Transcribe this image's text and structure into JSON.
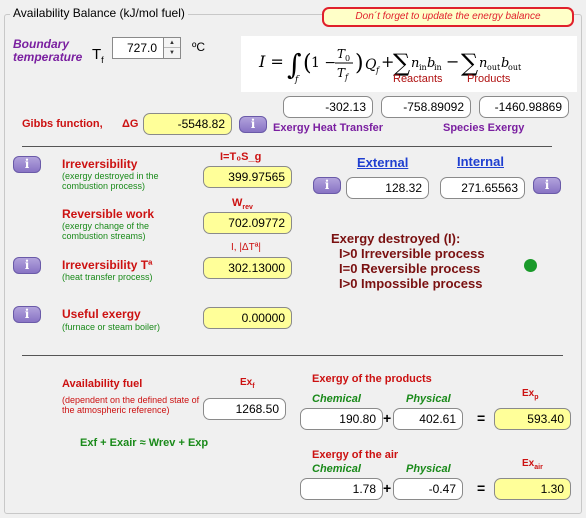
{
  "frame_title": "Availability Balance (kJ/mol fuel)",
  "banner": "Don´t forget to update the energy balance",
  "boundary": {
    "label1": "Boundary",
    "label2": "temperature",
    "symbol": "T",
    "subscript": "f",
    "value": "727.0",
    "unit": "ºC"
  },
  "formula": {
    "reactants": "Reactants",
    "products": "Products"
  },
  "formula_values": [
    "-302.13",
    "-758.89092",
    "-1460.98869"
  ],
  "gibbs": {
    "label": "Gibbs function,",
    "symbol": "ΔG",
    "value": "-5548.82",
    "exergy_heat": "Exergy Heat Transfer",
    "species_exergy": "Species Exergy"
  },
  "irreversibility": {
    "title": "Irreversibility",
    "desc": "(exergy destroyed in the combustion process)",
    "formula": "I=T₀S_g",
    "value": "399.97565"
  },
  "external_internal": {
    "external_label": "External",
    "internal_label": "Internal",
    "external_value": "128.32",
    "internal_value": "271.65563"
  },
  "reversible": {
    "title": "Reversible work",
    "desc": "(exergy change of the combustion streams)",
    "symbol": "W",
    "subscript": "rev",
    "value": "702.09772"
  },
  "exergy_destroyed": {
    "title": "Exergy destroyed (I):",
    "lines": [
      "I>0 Irreversible process",
      "I=0 Reversible process",
      "I>0 Impossible process"
    ],
    "status_color": "#1a9a2a"
  },
  "irrev_t": {
    "title": "Irreversibility Tª",
    "desc": "(heat transfer process)",
    "formula": "I, |ΔTª|",
    "value": "302.13000"
  },
  "useful": {
    "title": "Useful exergy",
    "desc": "(furnace or steam boiler)",
    "value": "0.00000"
  },
  "availability": {
    "title": "Availability fuel",
    "desc": "(dependent on the defined state of the atmospheric reference)",
    "symbol": "Ex",
    "subscript": "f",
    "value": "1268.50",
    "equation": "Exf + Exair ≈ Wrev + Exp"
  },
  "products": {
    "title": "Exergy of the products",
    "chemical_label": "Chemical",
    "physical_label": "Physical",
    "chemical": "190.80",
    "physical": "402.61",
    "symbol": "Ex",
    "subscript": "p",
    "total": "593.40"
  },
  "air": {
    "title": "Exergy of the air",
    "chemical_label": "Chemical",
    "physical_label": "Physical",
    "chemical": "1.78",
    "physical": "-0.47",
    "symbol": "Ex",
    "subscript": "air",
    "total": "1.30"
  },
  "ops": {
    "plus": "+",
    "equals": "="
  },
  "info_icon_glyph": "i"
}
